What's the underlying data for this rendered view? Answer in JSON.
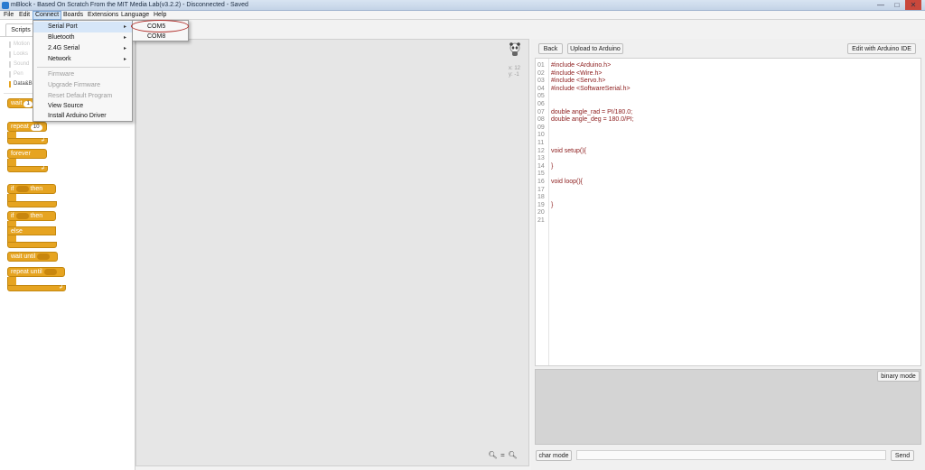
{
  "window": {
    "title": "mBlock - Based On Scratch From the MIT Media Lab(v3.2.2) - Disconnected - Saved",
    "minimize": "—",
    "maximize": "□",
    "close": "✕"
  },
  "menubar": {
    "items": [
      "File",
      "Edit",
      "Connect",
      "Boards",
      "Extensions",
      "Language",
      "Help"
    ]
  },
  "connect_menu": {
    "items": [
      {
        "label": "Serial Port",
        "has_submenu": true
      },
      {
        "label": "Bluetooth",
        "has_submenu": true
      },
      {
        "label": "2.4G Serial",
        "has_submenu": true
      },
      {
        "label": "Network",
        "has_submenu": true
      },
      {
        "label": "Firmware",
        "disabled": true
      },
      {
        "label": "Upgrade Firmware",
        "disabled": true
      },
      {
        "label": "Reset Default Program",
        "disabled": true
      },
      {
        "label": "View Source"
      },
      {
        "label": "Install Arduino Driver"
      }
    ],
    "arrow": "▸"
  },
  "serial_submenu": {
    "items": [
      "COM5",
      "COM8"
    ]
  },
  "left_panel": {
    "tab": "Scripts",
    "categories": [
      "Motion",
      "Looks",
      "Sound",
      "Pen",
      "Data&Blocks"
    ],
    "blocks": {
      "wait": "wait",
      "wait_value": "1",
      "repeat": "repeat",
      "repeat_value": "10",
      "forever": "forever",
      "if_then_if": "if",
      "if_then_then": "then",
      "if_else_if": "if",
      "if_else_then": "then",
      "else": "else",
      "wait_until": "wait until",
      "repeat_until": "repeat until"
    }
  },
  "stage": {
    "coords_x": "x: 12",
    "coords_y": "y: -1",
    "zoom_out": "🔍︎",
    "zoom_reset": "=",
    "zoom_in": "🔍︎"
  },
  "code_panel": {
    "back": "Back",
    "upload": "Upload to Arduino",
    "edit_ide": "Edit with Arduino IDE",
    "lines": [
      {
        "n": "01",
        "text": "#include <Arduino.h>"
      },
      {
        "n": "02",
        "text": "#include <Wire.h>"
      },
      {
        "n": "03",
        "text": "#include <Servo.h>"
      },
      {
        "n": "04",
        "text": "#include <SoftwareSerial.h>"
      },
      {
        "n": "05",
        "text": ""
      },
      {
        "n": "06",
        "text": ""
      },
      {
        "n": "07",
        "text": "double angle_rad = PI/180.0;"
      },
      {
        "n": "08",
        "text": "double angle_deg = 180.0/PI;"
      },
      {
        "n": "09",
        "text": ""
      },
      {
        "n": "10",
        "text": ""
      },
      {
        "n": "11",
        "text": ""
      },
      {
        "n": "12",
        "text": "void setup(){"
      },
      {
        "n": "13",
        "text": ""
      },
      {
        "n": "14",
        "text": "}"
      },
      {
        "n": "15",
        "text": ""
      },
      {
        "n": "16",
        "text": "void loop(){"
      },
      {
        "n": "17",
        "text": ""
      },
      {
        "n": "18",
        "text": ""
      },
      {
        "n": "19",
        "text": "}"
      },
      {
        "n": "20",
        "text": ""
      },
      {
        "n": "21",
        "text": ""
      }
    ],
    "binary_mode": "binary mode",
    "char_mode": "char mode",
    "send": "Send",
    "serial_input_value": ""
  },
  "colors": {
    "control_block": "#e6a421",
    "menu_highlight": "#d6e6f8",
    "annotation_circle": "#b1302c"
  }
}
